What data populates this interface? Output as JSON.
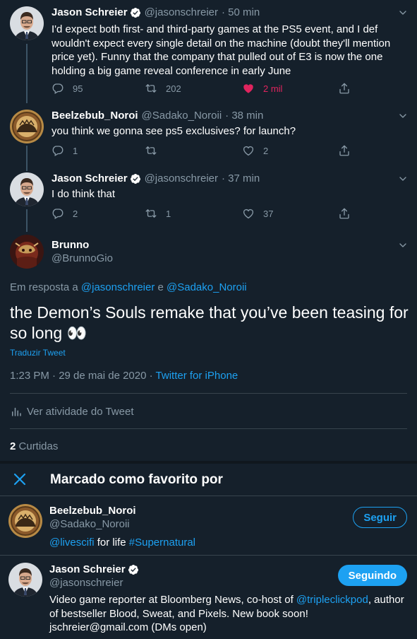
{
  "thread": [
    {
      "name": "Jason Schreier",
      "handle": "@jasonschreier",
      "time": "· 50 min",
      "text": "I'd expect both first- and third-party games at the PS5 event, and I def wouldn't expect every single detail on the machine (doubt they'll mention price yet). Funny that the company that pulled out of E3 is now the one holding a big game reveal conference in early June",
      "replies": "95",
      "retweets": "202",
      "likes": "2 mil",
      "liked": true
    },
    {
      "name": "Beelzebub_Noroi",
      "handle": "@Sadako_Noroii",
      "time": "· 38 min",
      "text": "you think we gonna see ps5 exclusives? for launch?",
      "replies": "1",
      "retweets": "",
      "likes": "2",
      "liked": false
    },
    {
      "name": "Jason Schreier",
      "handle": "@jasonschreier",
      "time": "· 37 min",
      "text": "I do think that",
      "replies": "2",
      "retweets": "1",
      "likes": "37",
      "liked": false
    }
  ],
  "main_tweet": {
    "name": "Brunno",
    "handle": "@BrunnoGio",
    "reply_prefix": "Em resposta a",
    "reply_user1": "@jasonschreier",
    "reply_conj": "e",
    "reply_user2": "@Sadako_Noroii",
    "text": "the Demon’s Souls remake that you’ve been teasing for so long 👀",
    "translate": "Traduzir Tweet",
    "timestamp": "1:23 PM · 29 de mai de 2020 ·",
    "source": "Twitter for iPhone",
    "activity": "Ver atividade do Tweet",
    "likes_count": "2",
    "likes_label": "Curtidas"
  },
  "modal": {
    "title": "Marcado como favorito por",
    "users": [
      {
        "name": "Beelzebub_Noroi",
        "handle": "@Sadako_Noroii",
        "bio_link1": "@livescifi",
        "bio_mid": " for life ",
        "bio_link2": "#Supernatural",
        "button": "Seguir"
      },
      {
        "name": "Jason Schreier",
        "handle": "@jasonschreier",
        "bio_pre": "Video game reporter at Bloomberg News, co-host of ",
        "bio_link1": "@tripleclickpod",
        "bio_post": ", author of bestseller Blood, Sweat, and Pixels. New book soon! jschreier@gmail.com (DMs open)",
        "button": "Seguindo"
      }
    ]
  },
  "colors": {
    "background": "#15202b",
    "accent": "#1da1f2",
    "muted": "#8899a6",
    "like": "#e0245e",
    "border": "#38444d"
  }
}
